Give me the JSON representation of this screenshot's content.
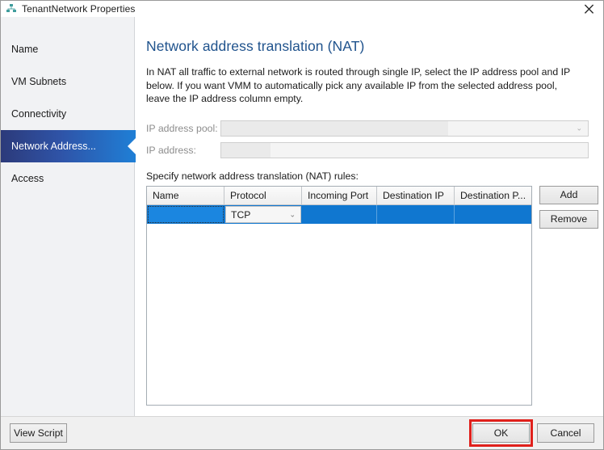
{
  "window": {
    "title": "TenantNetwork Properties",
    "icon": "network-hub-icon",
    "close_label": "✕"
  },
  "sidebar": {
    "items": [
      {
        "label": "Name",
        "selected": false
      },
      {
        "label": "VM Subnets",
        "selected": false
      },
      {
        "label": "Connectivity",
        "selected": false
      },
      {
        "label": "Network Address...",
        "selected": true
      },
      {
        "label": "Access",
        "selected": false
      }
    ]
  },
  "main": {
    "title": "Network address translation (NAT)",
    "description": "In NAT all traffic to external network is routed through single IP, select the IP address pool and IP below. If you want VMM to automatically pick any available IP from the selected address pool, leave the IP address column empty.",
    "fields": {
      "pool_label": "IP address pool:",
      "pool_value": "",
      "pool_arrow": "⌄",
      "ip_label": "IP address:",
      "ip_value": ""
    },
    "rules_label": "Specify network address translation (NAT) rules:",
    "grid": {
      "columns": [
        "Name",
        "Protocol",
        "Incoming Port",
        "Destination IP",
        "Destination P..."
      ],
      "rows": [
        {
          "name": "",
          "protocol": "TCP",
          "protocol_arrow": "⌄",
          "incoming_port": "",
          "destination_ip": "",
          "destination_port": "",
          "selected": true
        }
      ]
    },
    "buttons": {
      "add": "Add",
      "remove": "Remove"
    }
  },
  "footer": {
    "view_script": "View Script",
    "ok": "OK",
    "cancel": "Cancel"
  },
  "colors": {
    "accent_blue": "#1077d0",
    "title_blue": "#20538d",
    "nav_selected_start": "#2c3a7a",
    "nav_selected_end": "#1f7fd6",
    "highlight_red": "#e0201b"
  }
}
